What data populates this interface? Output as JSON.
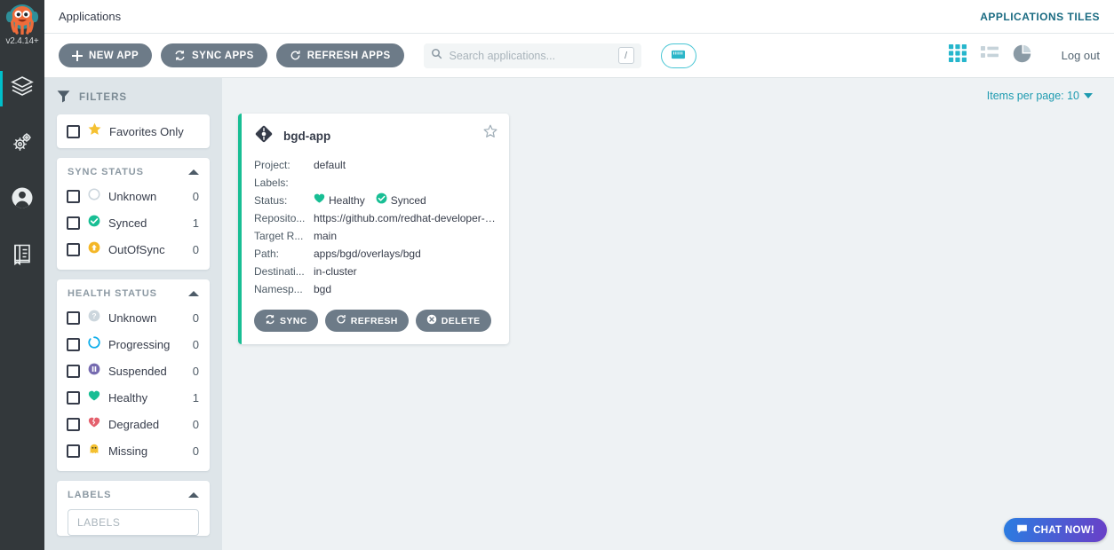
{
  "rail": {
    "logo_icon": "argo-octopus-logo",
    "version": "v2.4.14+",
    "items": [
      {
        "icon": "layers-icon",
        "name": "applications",
        "active": true
      },
      {
        "icon": "gears-icon",
        "name": "settings",
        "active": false
      },
      {
        "icon": "user-icon",
        "name": "user-info",
        "active": false
      },
      {
        "icon": "book-icon",
        "name": "documentation",
        "active": false
      }
    ]
  },
  "topbar": {
    "title": "Applications",
    "right_label": "APPLICATIONS TILES"
  },
  "toolbar": {
    "new_app_label": "NEW APP",
    "sync_apps_label": "SYNC APPS",
    "refresh_apps_label": "REFRESH APPS",
    "search_placeholder": "Search applications...",
    "search_value": "",
    "search_shortcut": "/",
    "logout_label": "Log out",
    "view_tiles_active": true
  },
  "filters": {
    "header": "FILTERS",
    "favorites_only": "Favorites Only",
    "sync_status": {
      "title": "SYNC STATUS",
      "items": [
        {
          "label": "Unknown",
          "count": "0",
          "icon": "circle-unknown-icon",
          "color": "#ccd6dd"
        },
        {
          "label": "Synced",
          "count": "1",
          "icon": "check-circle-icon",
          "color": "#18be94"
        },
        {
          "label": "OutOfSync",
          "count": "0",
          "icon": "arrow-up-circle-icon",
          "color": "#f4c030"
        }
      ]
    },
    "health_status": {
      "title": "HEALTH STATUS",
      "items": [
        {
          "label": "Unknown",
          "count": "0",
          "icon": "question-circle-icon",
          "color": "#ccd6dd"
        },
        {
          "label": "Progressing",
          "count": "0",
          "icon": "spinner-icon",
          "color": "#0dadea"
        },
        {
          "label": "Suspended",
          "count": "0",
          "icon": "pause-circle-icon",
          "color": "#766bb0"
        },
        {
          "label": "Healthy",
          "count": "1",
          "icon": "heart-icon",
          "color": "#18be94"
        },
        {
          "label": "Degraded",
          "count": "0",
          "icon": "broken-heart-icon",
          "color": "#e96d76"
        },
        {
          "label": "Missing",
          "count": "0",
          "icon": "ghost-icon",
          "color": "#f4c030"
        }
      ]
    },
    "labels": {
      "title": "LABELS",
      "input_placeholder": "LABELS",
      "input_value": ""
    }
  },
  "panel": {
    "items_per_page_label": "Items per page: 10"
  },
  "app_card": {
    "name": "bgd-app",
    "icon": "app-diamond-icon",
    "favorite_icon": "star-outline-icon",
    "status_bar_color": "#18be94",
    "fields": [
      {
        "key": "Project:",
        "value": "default"
      },
      {
        "key": "Labels:",
        "value": ""
      },
      {
        "key": "Reposito...",
        "value": "https://github.com/redhat-developer-de..."
      },
      {
        "key": "Target R...",
        "value": "main"
      },
      {
        "key": "Path:",
        "value": "apps/bgd/overlays/bgd"
      },
      {
        "key": "Destinati...",
        "value": "in-cluster"
      },
      {
        "key": "Namesp...",
        "value": "bgd"
      }
    ],
    "status": {
      "key": "Status:",
      "health_label": "Healthy",
      "health_icon": "heart-icon",
      "sync_label": "Synced",
      "sync_icon": "check-circle-icon"
    },
    "buttons": [
      {
        "label": "SYNC",
        "icon": "sync-icon"
      },
      {
        "label": "REFRESH",
        "icon": "refresh-icon"
      },
      {
        "label": "DELETE",
        "icon": "delete-circle-icon"
      }
    ]
  },
  "chat": {
    "label": "CHAT NOW!",
    "icon": "chat-bubble-icon"
  }
}
